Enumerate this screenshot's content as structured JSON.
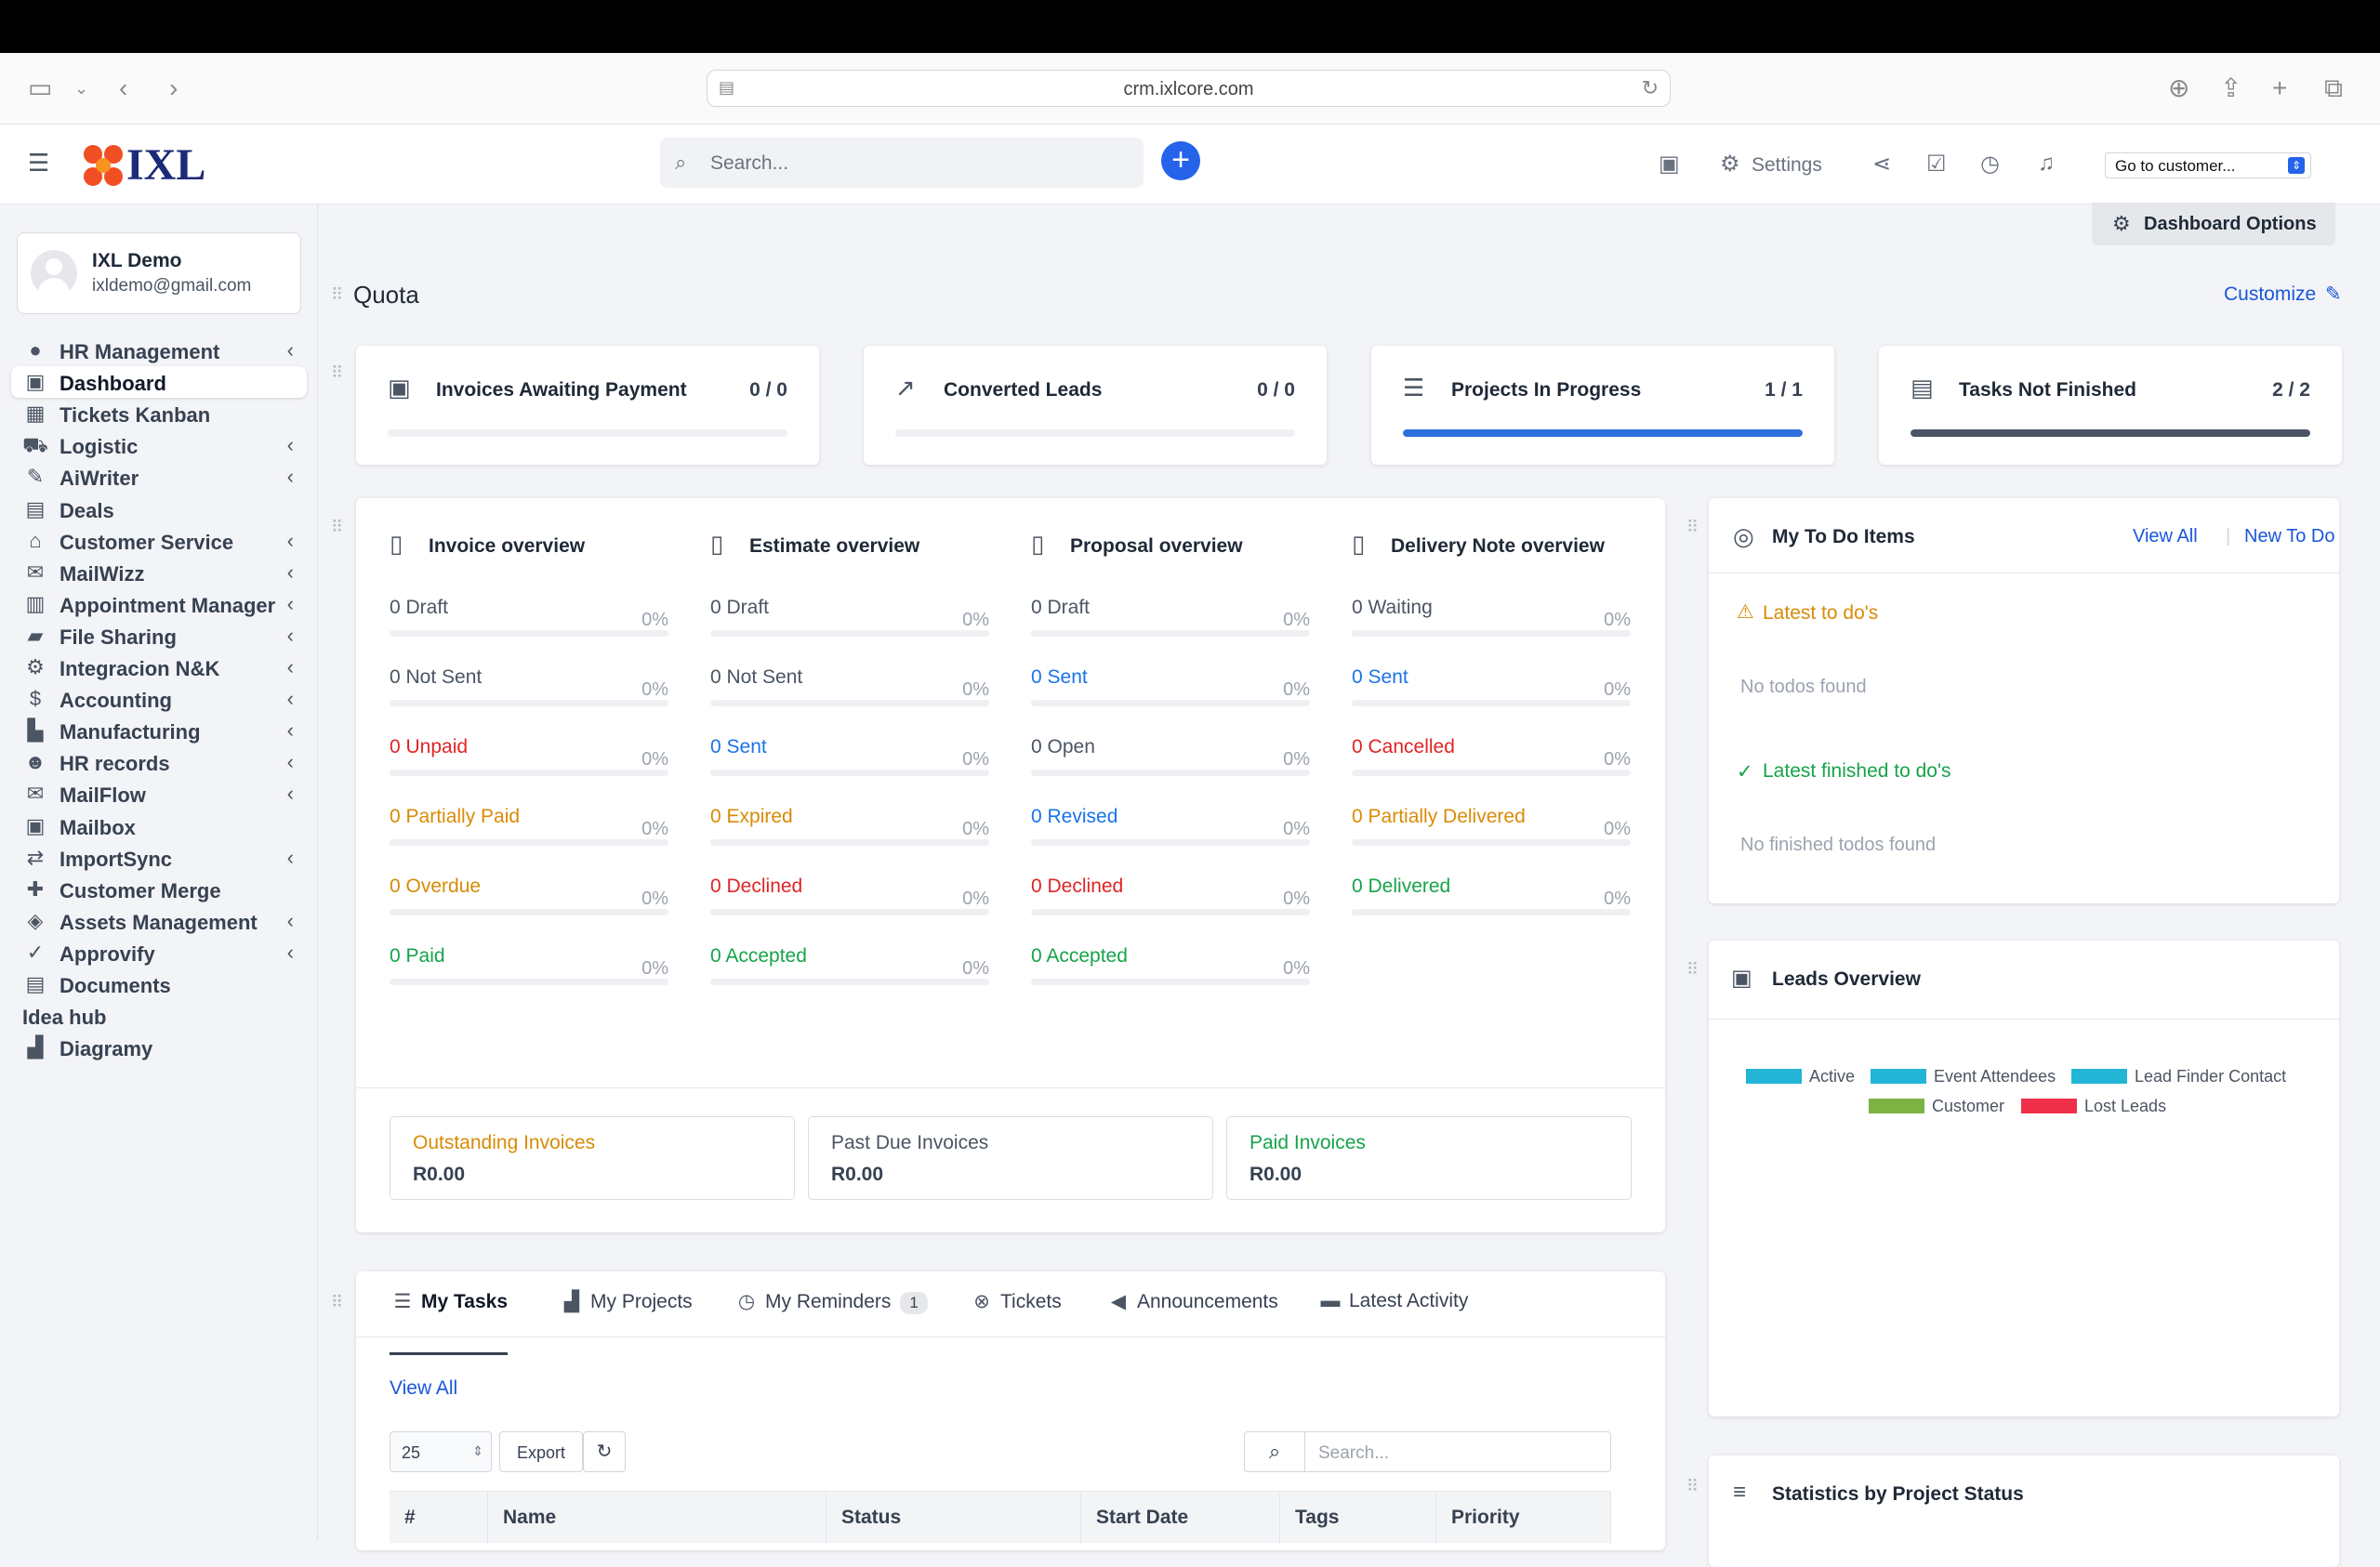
{
  "browser": {
    "url": "crm.ixlcore.com"
  },
  "header": {
    "logo_text": "IXL",
    "search_placeholder": "Search...",
    "settings_label": "Settings",
    "goto_customer": "Go to customer...",
    "dashboard_options": "Dashboard Options"
  },
  "user": {
    "name": "IXL Demo",
    "email": "ixldemo@gmail.com"
  },
  "sidebar": {
    "items": [
      {
        "label": "HR Management",
        "icon": "user-circle-icon",
        "chevron": true
      },
      {
        "label": "Dashboard",
        "icon": "dashboard-icon",
        "chevron": false,
        "active": true
      },
      {
        "label": "Tickets Kanban",
        "icon": "kanban-icon",
        "chevron": false
      },
      {
        "label": "Logistic",
        "icon": "truck-icon",
        "chevron": true
      },
      {
        "label": "AiWriter",
        "icon": "pen-icon",
        "chevron": true
      },
      {
        "label": "Deals",
        "icon": "document-icon",
        "chevron": false
      },
      {
        "label": "Customer Service",
        "icon": "bank-icon",
        "chevron": true
      },
      {
        "label": "MailWizz",
        "icon": "envelope-icon",
        "chevron": true
      },
      {
        "label": "Appointment Manager",
        "icon": "calendar-icon",
        "chevron": true
      },
      {
        "label": "File Sharing",
        "icon": "folder-icon",
        "chevron": true
      },
      {
        "label": "Integracion N&K",
        "icon": "cogs-icon",
        "chevron": true
      },
      {
        "label": "Accounting",
        "icon": "dollar-icon",
        "chevron": true
      },
      {
        "label": "Manufacturing",
        "icon": "factory-icon",
        "chevron": true
      },
      {
        "label": "HR records",
        "icon": "users-icon",
        "chevron": true
      },
      {
        "label": "MailFlow",
        "icon": "envelope-outline-icon",
        "chevron": true
      },
      {
        "label": "Mailbox",
        "icon": "mailbox-icon",
        "chevron": false
      },
      {
        "label": "ImportSync",
        "icon": "exchange-icon",
        "chevron": true
      },
      {
        "label": "Customer Merge",
        "icon": "puzzle-icon",
        "chevron": false
      },
      {
        "label": "Assets Management",
        "icon": "cube-icon",
        "chevron": true
      },
      {
        "label": "Approvify",
        "icon": "check-icon",
        "chevron": true
      },
      {
        "label": "Documents",
        "icon": "document-icon",
        "chevron": false
      },
      {
        "label": "Idea hub",
        "icon": "",
        "chevron": false
      },
      {
        "label": "Diagramy",
        "icon": "chart-icon",
        "chevron": false
      }
    ]
  },
  "quota": {
    "title": "Quota",
    "customize": "Customize",
    "cards": [
      {
        "title": "Invoices Awaiting Payment",
        "value": "0 / 0",
        "progress": 0,
        "color": "#2f6fde"
      },
      {
        "title": "Converted Leads",
        "value": "0 / 0",
        "progress": 0,
        "color": "#2f6fde"
      },
      {
        "title": "Projects In Progress",
        "value": "1 / 1",
        "progress": 1,
        "color": "#2f6fde"
      },
      {
        "title": "Tasks Not Finished",
        "value": "2 / 2",
        "progress": 1,
        "color": "#4b5563"
      }
    ]
  },
  "overview": {
    "columns": [
      {
        "title": "Invoice overview",
        "rows": [
          {
            "label": "0 Draft",
            "pct": "0%",
            "color": "gray"
          },
          {
            "label": "0 Not Sent",
            "pct": "0%",
            "color": "gray"
          },
          {
            "label": "0 Unpaid",
            "pct": "0%",
            "color": "red"
          },
          {
            "label": "0 Partially Paid",
            "pct": "0%",
            "color": "orange"
          },
          {
            "label": "0 Overdue",
            "pct": "0%",
            "color": "orange"
          },
          {
            "label": "0 Paid",
            "pct": "0%",
            "color": "green"
          }
        ]
      },
      {
        "title": "Estimate overview",
        "rows": [
          {
            "label": "0 Draft",
            "pct": "0%",
            "color": "gray"
          },
          {
            "label": "0 Not Sent",
            "pct": "0%",
            "color": "gray"
          },
          {
            "label": "0 Sent",
            "pct": "0%",
            "color": "blue"
          },
          {
            "label": "0 Expired",
            "pct": "0%",
            "color": "orange"
          },
          {
            "label": "0 Declined",
            "pct": "0%",
            "color": "red"
          },
          {
            "label": "0 Accepted",
            "pct": "0%",
            "color": "green"
          }
        ]
      },
      {
        "title": "Proposal overview",
        "rows": [
          {
            "label": "0 Draft",
            "pct": "0%",
            "color": "gray"
          },
          {
            "label": "0 Sent",
            "pct": "0%",
            "color": "blue"
          },
          {
            "label": "0 Open",
            "pct": "0%",
            "color": "gray"
          },
          {
            "label": "0 Revised",
            "pct": "0%",
            "color": "blue"
          },
          {
            "label": "0 Declined",
            "pct": "0%",
            "color": "red"
          },
          {
            "label": "0 Accepted",
            "pct": "0%",
            "color": "green"
          }
        ]
      },
      {
        "title": "Delivery Note overview",
        "rows": [
          {
            "label": "0 Waiting",
            "pct": "0%",
            "color": "gray"
          },
          {
            "label": "0 Sent",
            "pct": "0%",
            "color": "blue"
          },
          {
            "label": "0 Cancelled",
            "pct": "0%",
            "color": "red"
          },
          {
            "label": "0 Partially Delivered",
            "pct": "0%",
            "color": "orange"
          },
          {
            "label": "0 Delivered",
            "pct": "0%",
            "color": "green"
          }
        ]
      }
    ],
    "summary": [
      {
        "title": "Outstanding Invoices",
        "value": "R0.00",
        "color": "orange"
      },
      {
        "title": "Past Due Invoices",
        "value": "R0.00",
        "color": "gray"
      },
      {
        "title": "Paid Invoices",
        "value": "R0.00",
        "color": "green"
      }
    ]
  },
  "tasks": {
    "tabs": [
      {
        "label": "My Tasks",
        "icon": "tasks-icon",
        "active": true
      },
      {
        "label": "My Projects",
        "icon": "chart-icon"
      },
      {
        "label": "My Reminders",
        "icon": "clock-icon",
        "badge": "1"
      },
      {
        "label": "Tickets",
        "icon": "lifering-icon"
      },
      {
        "label": "Announcements",
        "icon": "megaphone-icon"
      },
      {
        "label": "Latest Activity",
        "icon": "card-icon"
      }
    ],
    "view_all": "View All",
    "page_size": "25",
    "export": "Export",
    "search_placeholder": "Search...",
    "columns": [
      "#",
      "Name",
      "Status",
      "Start Date",
      "Tags",
      "Priority"
    ]
  },
  "todo": {
    "title": "My To Do Items",
    "view_all": "View All",
    "new_todo": "New To Do",
    "latest": "Latest to do's",
    "no_todos": "No todos found",
    "latest_finished": "Latest finished to do's",
    "no_finished": "No finished todos found"
  },
  "leads": {
    "title": "Leads Overview",
    "legend": [
      {
        "label": "Active",
        "color": "#22b5d6"
      },
      {
        "label": "Event Attendees",
        "color": "#22b5d6"
      },
      {
        "label": "Lead Finder Contact",
        "color": "#22b5d6"
      },
      {
        "label": "Customer",
        "color": "#7cb342"
      },
      {
        "label": "Lost Leads",
        "color": "#f0304a"
      }
    ]
  },
  "stats": {
    "title": "Statistics by Project Status"
  }
}
